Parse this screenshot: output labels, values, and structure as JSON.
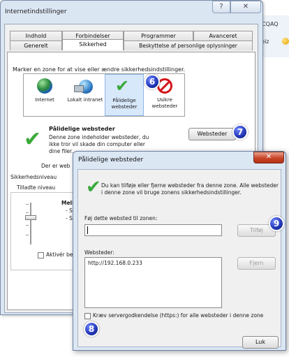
{
  "browser": {
    "address_fragment": "4CQAQ",
    "favorites_fragment": "robiz"
  },
  "internet_options": {
    "title": "Internetindstillinger",
    "tabs_row_back": [
      {
        "label": "Indhold"
      },
      {
        "label": "Forbindelser"
      },
      {
        "label": "Programmer"
      },
      {
        "label": "Avanceret"
      }
    ],
    "tabs_row_front": [
      {
        "label": "Generelt"
      },
      {
        "label": "Sikkerhed"
      },
      {
        "label": "Beskyttelse af personlige oplysninger"
      }
    ],
    "zone_select_label": "Marker en zone for at vise eller ændre sikkerhedsindstillinger.",
    "zones": [
      {
        "label": "Internet",
        "icon": "globe-icon"
      },
      {
        "label": "Lokalt intranet",
        "icon": "local-intranet-icon"
      },
      {
        "label": "Pålidelige websteder",
        "icon": "checkmark-icon"
      },
      {
        "label": "Usikre websteder",
        "icon": "no-entry-icon"
      }
    ],
    "zone_heading": "Pålidelige websteder",
    "zone_description": "Denne zone indeholder websteder, du ikke tror vil skade din computer eller dine filer.",
    "sites_button": "Websteder",
    "partial_text_1": "Der er web",
    "partial_text_2": "Sikkerhedsniveau",
    "partial_text_3": "Tilladte niveau",
    "level_text_1": "Mell",
    "level_text_2": "- S",
    "level_text_3": "- S",
    "protected_mode_label": "Aktivér bes"
  },
  "trusted_sites": {
    "title": "Pålidelige websteder",
    "info": "Du kan tilføje eller fjerne websteder fra denne zone. Alle websteder i denne zone vil bruge zonens sikkerhedsindstillinger.",
    "add_label": "Føj dette websted til zonen:",
    "add_value": "",
    "add_button": "Tilføj",
    "sites_label": "Websteder:",
    "sites": [
      "http://192.168.0.233"
    ],
    "remove_button": "Fjern",
    "https_label": "Kræv servergodkendelse (https:) for alle websteder i denne zone",
    "close_button": "Luk"
  },
  "annotations": [
    "6",
    "7",
    "8",
    "9"
  ],
  "colors": {
    "badge": "#2136b5",
    "check_green": "#3aa93a",
    "no_entry_red": "#d4141a",
    "close_red": "#c9462a"
  }
}
